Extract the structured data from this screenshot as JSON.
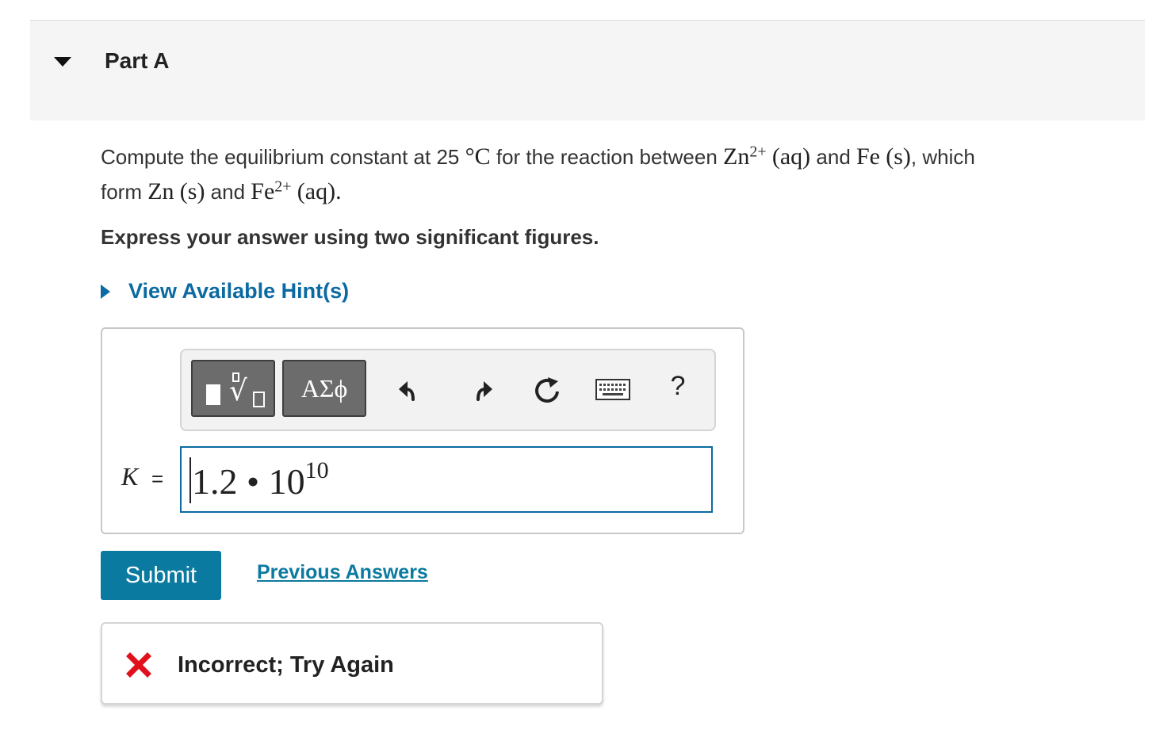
{
  "part": {
    "title": "Part A"
  },
  "question": {
    "t1": "Compute the equilibrium constant at 25 ",
    "deg": "°",
    "c": "C",
    "t2": " for the reaction between ",
    "zn": "Zn",
    "zn_charge": "2+",
    "aq1": "(aq)",
    "t3": " and ",
    "fe": "Fe",
    "s1": "(s)",
    "t4": ", which",
    "t5": "form ",
    "zn2": "Zn",
    "s2": "(s)",
    "t6": " and ",
    "fe2": "Fe",
    "fe_charge": "2+",
    "aq2": "(aq)",
    "end": "."
  },
  "instruction": "Express your answer using two significant figures.",
  "hint": {
    "label": "View Available Hint(s)"
  },
  "toolbar": {
    "templates_icon": "templates-icon",
    "symbols_label": "ΑΣϕ",
    "undo_icon": "undo-icon",
    "redo_icon": "redo-icon",
    "reset_icon": "reset-icon",
    "keyboard_icon": "keyboard-icon",
    "help_label": "?"
  },
  "answer": {
    "variable": "K",
    "equals": "=",
    "mantissa": "1.2",
    "times": "•",
    "base": "10",
    "exponent": "10"
  },
  "actions": {
    "submit_label": "Submit",
    "previous_answers_label": "Previous Answers"
  },
  "feedback": {
    "message": "Incorrect; Try Again",
    "icon": "x-mark-icon",
    "color": "#e0101c"
  },
  "colors": {
    "accent": "#0b7aa0",
    "link": "#0b6aa2",
    "header_bg": "#f5f5f5"
  }
}
